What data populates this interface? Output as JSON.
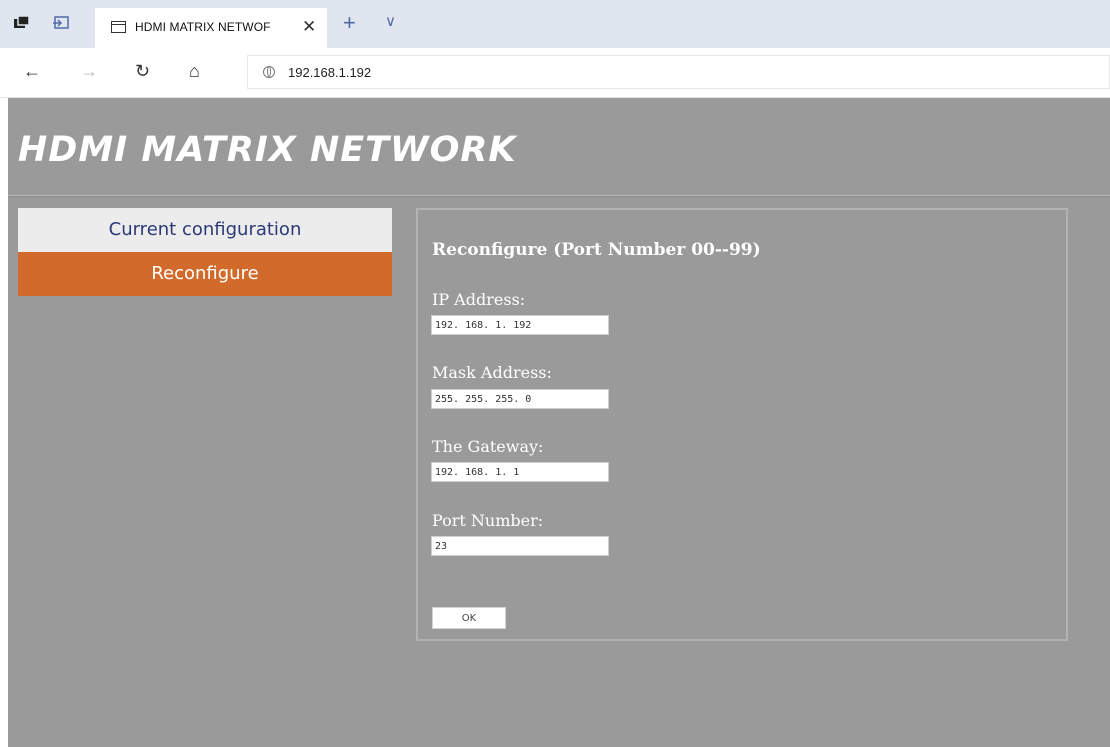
{
  "browser": {
    "tab_title": "HDMI MATRIX NETWOF",
    "close_glyph": "✕",
    "new_tab_glyph": "+",
    "tab_menu_glyph": "∨",
    "back_glyph": "←",
    "forward_glyph": "→",
    "refresh_glyph": "↻",
    "home_glyph": "⌂",
    "url": "192.168.1.192"
  },
  "page": {
    "title": "HDMI MATRIX NETWORK",
    "menu": {
      "current_configuration": "Current configuration",
      "reconfigure": "Reconfigure"
    },
    "form": {
      "title": "Reconfigure  (Port Number 00--99)",
      "ip_label": "IP Address:",
      "ip_value": "192. 168. 1. 192",
      "mask_label": "Mask Address:",
      "mask_value": "255. 255. 255. 0",
      "gateway_label": "The Gateway:",
      "gateway_value": "192. 168. 1. 1",
      "port_label": "Port Number:",
      "port_value": "23",
      "ok_label": "OK"
    },
    "colors": {
      "background": "#9a9a9a",
      "menu_active": "#d26a2b",
      "menu_inactive": "#ececec"
    }
  }
}
